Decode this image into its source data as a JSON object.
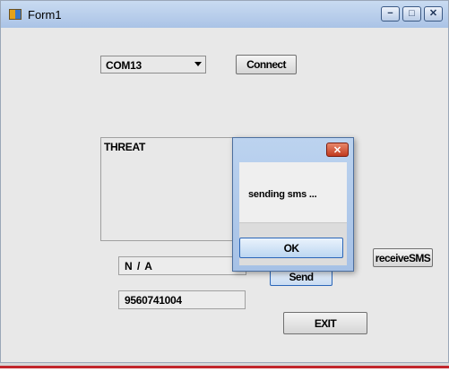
{
  "window": {
    "title": "Form1",
    "controls": {
      "minimize": "−",
      "maximize": "□",
      "close": "✕"
    }
  },
  "port": {
    "selected": "COM13"
  },
  "buttons": {
    "connect": "Connect",
    "receive_sms": "receiveSMS",
    "send": "Send",
    "exit": "EXIT"
  },
  "fields": {
    "threat": "THREAT",
    "status": "N / A",
    "phone": "9560741004"
  },
  "dialog": {
    "message": "sending sms ...",
    "ok": "OK",
    "close": "✕"
  },
  "colors": {
    "dialog_close": "#c13a1f",
    "accent_border": "#2b66b8",
    "bottom_bar": "#c1272d"
  },
  "icons": [
    "app-icon",
    "dropdown-arrow-icon",
    "close-icon"
  ]
}
